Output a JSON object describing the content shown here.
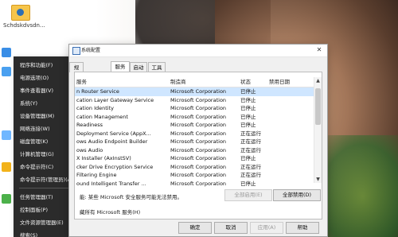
{
  "desktop": {
    "icon_label": "Schdskdvsdn..."
  },
  "winx_menu": {
    "items": [
      "程序和功能(F)",
      "电源选项(O)",
      "事件查看器(V)",
      "系统(Y)",
      "设备管理器(M)",
      "网络连接(W)",
      "磁盘管理(K)",
      "计算机管理(G)",
      "命令提示符(C)",
      "命令提示符(管理员)(A)",
      "任务管理器(T)",
      "控制面板(P)",
      "文件资源管理器(E)",
      "搜索(S)"
    ]
  },
  "system_config": {
    "title": "系统配置",
    "tabs": [
      "规",
      "服务",
      "启动",
      "工具"
    ],
    "active_tab_index": 1,
    "columns": [
      "服务",
      "制造商",
      "状态",
      "禁用日期"
    ],
    "rows": [
      {
        "service": "n Router Service",
        "manufacturer": "Microsoft Corporation",
        "status": "已停止",
        "disabled_date": ""
      },
      {
        "service": "cation Layer Gateway Service",
        "manufacturer": "Microsoft Corporation",
        "status": "已停止",
        "disabled_date": ""
      },
      {
        "service": "cation Identity",
        "manufacturer": "Microsoft Corporation",
        "status": "已停止",
        "disabled_date": ""
      },
      {
        "service": "cation Management",
        "manufacturer": "Microsoft Corporation",
        "status": "已停止",
        "disabled_date": ""
      },
      {
        "service": "Readiness",
        "manufacturer": "Microsoft Corporation",
        "status": "已停止",
        "disabled_date": ""
      },
      {
        "service": "Deployment Service (AppX...",
        "manufacturer": "Microsoft Corporation",
        "status": "正在运行",
        "disabled_date": ""
      },
      {
        "service": "ows Audio Endpoint Builder",
        "manufacturer": "Microsoft Corporation",
        "status": "正在运行",
        "disabled_date": ""
      },
      {
        "service": "ows Audio",
        "manufacturer": "Microsoft Corporation",
        "status": "正在运行",
        "disabled_date": ""
      },
      {
        "service": "X Installer (AxInstSV)",
        "manufacturer": "Microsoft Corporation",
        "status": "已停止",
        "disabled_date": ""
      },
      {
        "service": "cker Drive Encryption Service",
        "manufacturer": "Microsoft Corporation",
        "status": "正在运行",
        "disabled_date": ""
      },
      {
        "service": "Filtering Engine",
        "manufacturer": "Microsoft Corporation",
        "status": "正在运行",
        "disabled_date": ""
      },
      {
        "service": "ound Intelligent Transfer ...",
        "manufacturer": "Microsoft Corporation",
        "status": "已停止",
        "disabled_date": ""
      }
    ],
    "selected_row_index": 0,
    "note": "能: 某些 Microsoft 安全服务可能无法禁用。",
    "enable_all": "全部启用(E)",
    "disable_all": "全部禁用(D)",
    "hide_ms": "藏所有 Microsoft 服务(H)",
    "ok": "确定",
    "cancel": "取消",
    "apply": "应用(A)",
    "help": "帮助"
  }
}
